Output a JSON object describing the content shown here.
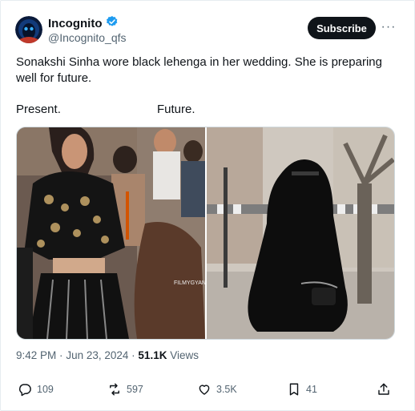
{
  "author": {
    "display_name": "Incognito",
    "handle": "@Incognito_qfs",
    "verified": true
  },
  "header": {
    "subscribe_label": "Subscribe",
    "more_glyph": "···"
  },
  "tweet": {
    "text": "Sonakshi Sinha wore black lehenga in her wedding. She is preparing well for future.",
    "label_left": "Present.",
    "label_right": "Future.",
    "image_watermark": "FILMYGYAN"
  },
  "meta": {
    "time": "9:42 PM",
    "separator": "·",
    "date": "Jun 23, 2024",
    "views_count": "51.1K",
    "views_label": "Views"
  },
  "actions": {
    "replies": "109",
    "reposts": "597",
    "likes": "3.5K",
    "bookmarks": "41"
  },
  "colors": {
    "accent": "#1d9bf0",
    "text": "#0f1419",
    "secondary": "#536471"
  }
}
